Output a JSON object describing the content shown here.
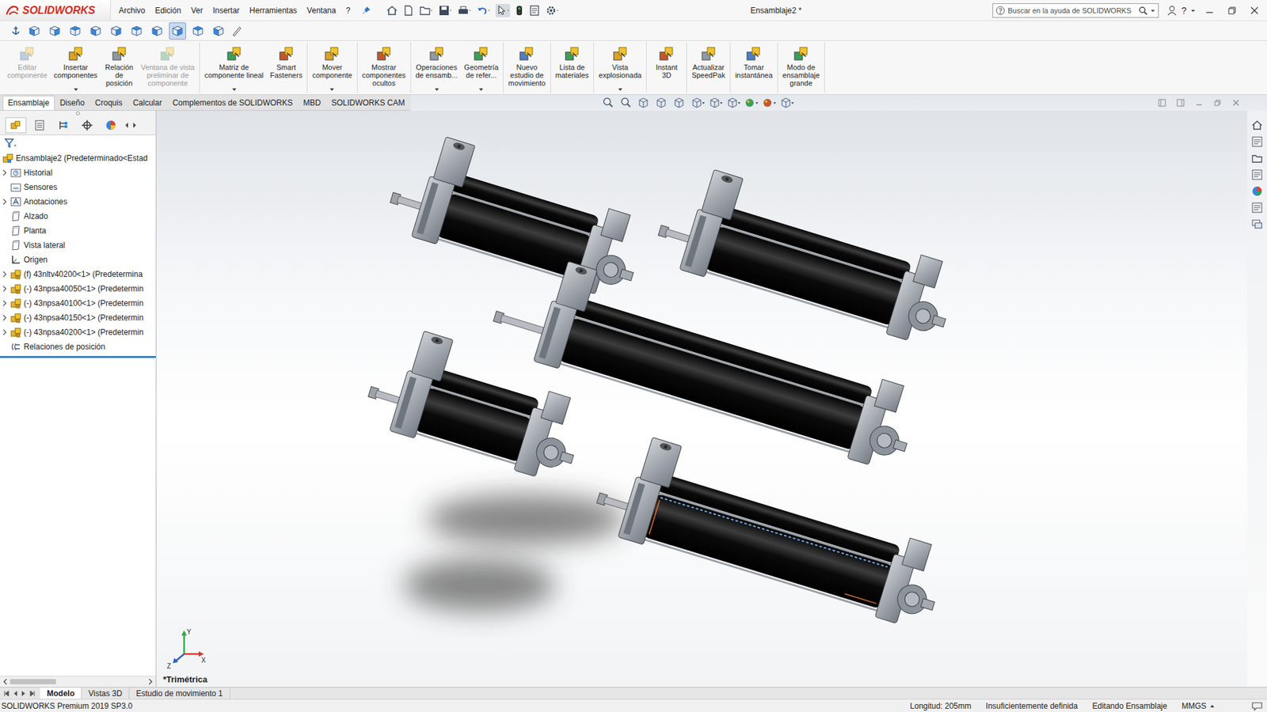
{
  "app": {
    "logo": "SOLIDWORKS",
    "menus": [
      "Archivo",
      "Edición",
      "Ver",
      "Insertar",
      "Herramientas",
      "Ventana",
      "?"
    ],
    "title": "Ensamblaje2 *",
    "help": "?"
  },
  "search": {
    "placeholder": "Buscar en la ayuda de SOLIDWORKS"
  },
  "view_toolbar": [
    {
      "selected": false
    },
    {
      "selected": false
    },
    {
      "selected": false
    },
    {
      "selected": false
    },
    {
      "selected": false
    },
    {
      "selected": false
    },
    {
      "selected": false
    },
    {
      "selected": true
    },
    {
      "selected": false
    },
    {
      "selected": false
    }
  ],
  "ribbon": {
    "groups": [
      {
        "buttons": [
          {
            "label": "Editar\ncomponente",
            "disabled": true,
            "dropdown": false
          },
          {
            "label": "Insertar\ncomponentes",
            "disabled": false,
            "dropdown": true
          },
          {
            "label": "Relación\nde\nposición",
            "disabled": false,
            "dropdown": false
          },
          {
            "label": "Ventana de vista\npreliminar de\ncomponente",
            "disabled": true,
            "dropdown": false
          }
        ]
      },
      {
        "buttons": [
          {
            "label": "Matriz de\ncomponente lineal",
            "disabled": false,
            "dropdown": true
          },
          {
            "label": "Smart\nFasteners",
            "disabled": false,
            "dropdown": false
          }
        ]
      },
      {
        "buttons": [
          {
            "label": "Mover\ncomponente",
            "disabled": false,
            "dropdown": true
          }
        ]
      },
      {
        "buttons": [
          {
            "label": "Mostrar\ncomponentes\nocultos",
            "disabled": false,
            "dropdown": false
          }
        ]
      },
      {
        "buttons": [
          {
            "label": "Operaciones\nde ensamb...",
            "disabled": false,
            "dropdown": true
          },
          {
            "label": "Geometría\nde refer...",
            "disabled": false,
            "dropdown": true
          }
        ]
      },
      {
        "buttons": [
          {
            "label": "Nuevo\nestudio de\nmovimiento",
            "disabled": false,
            "dropdown": false
          }
        ]
      },
      {
        "buttons": [
          {
            "label": "Lista de\nmateriales",
            "disabled": false,
            "dropdown": false
          }
        ]
      },
      {
        "buttons": [
          {
            "label": "Vista\nexplosionada",
            "disabled": false,
            "dropdown": true
          }
        ]
      },
      {
        "buttons": [
          {
            "label": "Instant\n3D",
            "disabled": false,
            "dropdown": false
          }
        ]
      },
      {
        "buttons": [
          {
            "label": "Actualizar\nSpeedPak",
            "disabled": false,
            "dropdown": false
          }
        ]
      },
      {
        "buttons": [
          {
            "label": "Tomar\ninstantánea",
            "disabled": false,
            "dropdown": false
          }
        ]
      },
      {
        "buttons": [
          {
            "label": "Modo de\nensamblaje\ngrande",
            "disabled": false,
            "dropdown": false
          }
        ]
      }
    ]
  },
  "ribbon_tabs": [
    {
      "label": "Ensamblaje",
      "selected": true
    },
    {
      "label": "Diseño",
      "selected": false
    },
    {
      "label": "Croquis",
      "selected": false
    },
    {
      "label": "Calcular",
      "selected": false
    },
    {
      "label": "Complementos de SOLIDWORKS",
      "selected": false
    },
    {
      "label": "MBD",
      "selected": false
    },
    {
      "label": "SOLIDWORKS CAM",
      "selected": false
    }
  ],
  "panel_tabs": [
    {
      "selected": true
    },
    {
      "selected": false
    },
    {
      "selected": false
    },
    {
      "selected": false
    },
    {
      "selected": false
    }
  ],
  "feature_tree": {
    "root": {
      "label": "Ensamblaje2 (Predeterminado<Estad",
      "selected": false
    },
    "items": [
      {
        "label": "Historial",
        "kind": "history",
        "expandable": true,
        "selected": false
      },
      {
        "label": "Sensores",
        "kind": "sensor",
        "expandable": false,
        "selected": false
      },
      {
        "label": "Anotaciones",
        "kind": "annotation",
        "expandable": true,
        "selected": false
      },
      {
        "label": "Alzado",
        "kind": "plane",
        "expandable": false,
        "selected": false
      },
      {
        "label": "Planta",
        "kind": "plane",
        "expandable": false,
        "selected": false
      },
      {
        "label": "Vista lateral",
        "kind": "plane",
        "expandable": false,
        "selected": false
      },
      {
        "label": "Origen",
        "kind": "origin",
        "expandable": false,
        "selected": false
      },
      {
        "label": "(f) 43nltv40200<1> (Predetermina",
        "kind": "component",
        "expandable": true,
        "selected": false
      },
      {
        "label": "(-) 43npsa40050<1> (Predetermin",
        "kind": "component",
        "expandable": true,
        "selected": false
      },
      {
        "label": "(-) 43npsa40100<1> (Predetermin",
        "kind": "component",
        "expandable": true,
        "selected": false
      },
      {
        "label": "(-) 43npsa40150<1> (Predetermin",
        "kind": "component",
        "expandable": true,
        "selected": false
      },
      {
        "label": "(-) 43npsa40200<1> (Predetermin",
        "kind": "component",
        "expandable": true,
        "selected": false
      },
      {
        "label": "Relaciones de posición",
        "kind": "mates",
        "expandable": false,
        "selected": false
      }
    ]
  },
  "view": {
    "name": "*Trimétrica",
    "triad": [
      "Y",
      "X",
      "Z"
    ]
  },
  "bottom_tabs": [
    {
      "label": "Modelo",
      "selected": true
    },
    {
      "label": "Vistas 3D",
      "selected": false
    },
    {
      "label": "Estudio de movimiento 1",
      "selected": false
    }
  ],
  "status_bar": {
    "product": "SOLIDWORKS Premium 2019 SP3.0",
    "fields": [
      "Longitud: 205mm",
      "Insuficientemente definida",
      "Editando Ensamblaje",
      "MMGS"
    ]
  }
}
